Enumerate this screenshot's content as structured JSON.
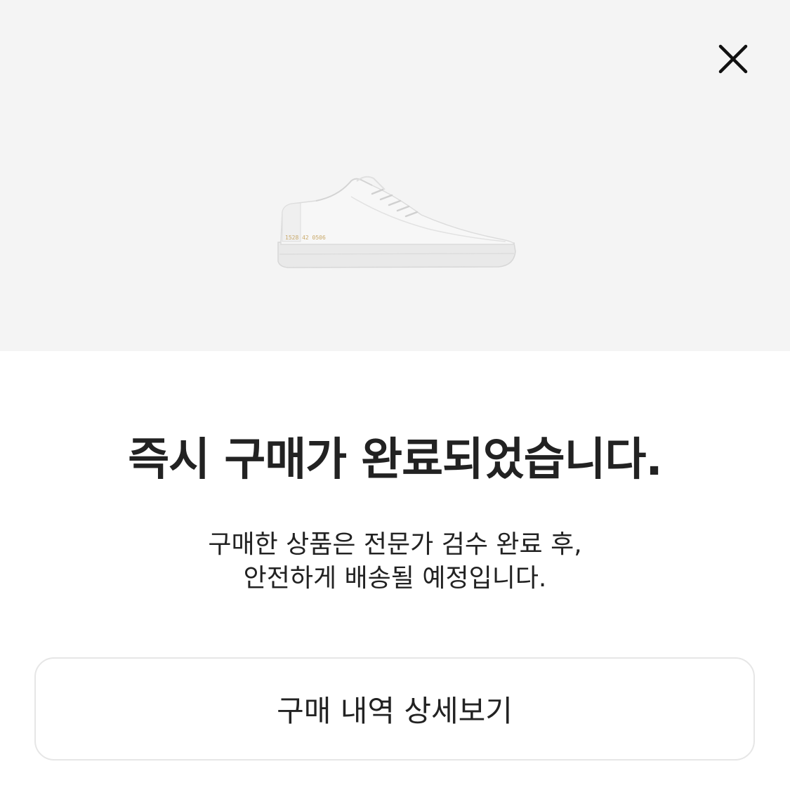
{
  "hero": {
    "background_color": "#f4f4f4",
    "product_image_icon": "white-low-top-sneaker",
    "product_print": "1528 42 0506",
    "close_icon": "close-icon"
  },
  "title": "즉시 구매가 완료되었습니다.",
  "description": {
    "line1": "구매한 상품은 전문가 검수 완료 후,",
    "line2": "안전하게 배송될 예정입니다."
  },
  "detail_button": {
    "label": "구매 내역 상세보기"
  },
  "colors": {
    "text": "#222222",
    "button_border": "#e6e6e6",
    "hero_background": "#f4f4f4"
  }
}
